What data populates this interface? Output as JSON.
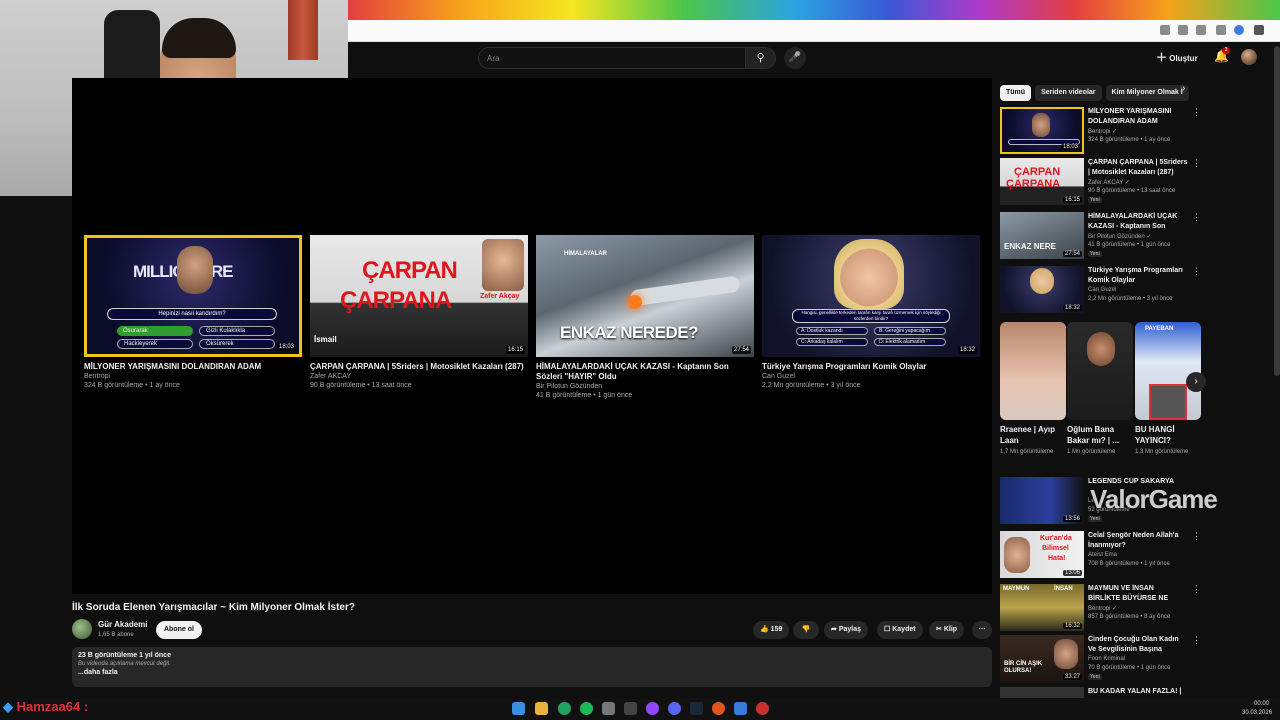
{
  "header": {
    "search_placeholder": "Ara",
    "create_label": "Oluştur",
    "notification_count": "3"
  },
  "colors": {
    "background": "#0f0f0f",
    "surface": "#272727",
    "text": "#f1f1f1",
    "muted": "#aaaaaa",
    "accent_red": "#cc0000"
  },
  "endscreen": [
    {
      "title": "MİLYONER YARIŞMASINI DOLANDIRAN ADAM",
      "channel": "Bentropi",
      "meta": "324 B görüntüleme • 1 ay önce",
      "duration": "18:03"
    },
    {
      "title": "ÇARPAN ÇARPANA | 5Sriders | Motosiklet Kazaları (287)",
      "channel": "Zafer AKCAY",
      "meta": "90 B görüntüleme • 13 saat önce",
      "duration": "16:15"
    },
    {
      "title": "HİMALAYALARDAKİ UÇAK KAZASI - Kaptanın Son Sözleri \"HAYIR\" Oldu",
      "channel": "Bir Pilotun Gözünden",
      "meta": "41 B görüntüleme • 1 gün önce",
      "duration": "27:54"
    },
    {
      "title": "Türkiye Yarışma Programları Komik Olaylar",
      "channel": "Can Guzel",
      "meta": "2,2 Mn görüntüleme • 3 yıl önce",
      "duration": "18:32"
    }
  ],
  "thumb_text": {
    "millionaire_logo": "MILLIONAIRE",
    "millionaire_question": "Hepinizi nasıl kandırdım?",
    "millionaire_a": "Osurarak",
    "millionaire_b": "Gizli Kulaklıkla",
    "millionaire_c": "Hackleyerek",
    "millionaire_d": "Öksürerek",
    "carpan_line1": "ÇARPAN",
    "carpan_line2": "ÇARPANA",
    "carpan_name": "Zafer Akçay",
    "carpan_tag": "İsmail",
    "enkaz": "ENKAZ NEREDE?",
    "enkaz_logo": "HİMALAYALAR",
    "quiz_question": "Hangisi, genellikle terkeden tarafın karşı tarafı üzmemek için söylediği sözlerden biridir?",
    "quiz_a": "A: Dostluk kazandı",
    "quiz_b": "B: Gereğini yapacağım",
    "quiz_c": "C: Arkadaş kalalım",
    "quiz_d": "D: Elektrik alamadım"
  },
  "video": {
    "title": "İlk Soruda Elenen Yarışmacılar ~ Kim Milyoner Olmak İster?",
    "channel": "Gür Akademi",
    "subscribers": "1,65 B abone",
    "subscribe_label": "Abone ol",
    "likes": "159",
    "share_label": "Paylaş",
    "save_label": "Kaydet",
    "clip_label": "Klip",
    "views_date": "23 B görüntüleme  1 yıl önce",
    "description": "Bu videoda açıklama mevcut değil.",
    "more_label": "...daha fazla"
  },
  "chips": [
    "Tümü",
    "Seriden videolar",
    "Kim Milyoner Olmak İ"
  ],
  "recommendations_top": [
    {
      "title": "MİLYONER YARIŞMASINI DOLANDIRAN ADAM",
      "channel": "Bentropi ✓",
      "meta": "324 B görüntüleme • 1 ay önce",
      "duration": "18:03",
      "badge": ""
    },
    {
      "title": "ÇARPAN ÇARPANA | 5Sriders | Motosiklet Kazaları (287)",
      "channel": "Zafer AKCAY ✓",
      "meta": "90 B görüntüleme • 13 saat önce",
      "duration": "16:15",
      "badge": "Yeni"
    },
    {
      "title": "HİMALAYALARDAKİ UÇAK KAZASI - Kaptanın Son Sözleri...",
      "channel": "Bir Pilotun Gözünden ✓",
      "meta": "41 B görüntüleme • 1 gün önce",
      "duration": "27:54",
      "badge": "Yeni"
    },
    {
      "title": "Türkiye Yarışma Programları Komik Olaylar",
      "channel": "Can Guzel",
      "meta": "2,2 Mn görüntüleme • 3 yıl önce",
      "duration": "18:32",
      "badge": ""
    }
  ],
  "shorts": [
    {
      "title": "Rraenee | Ayıp Laan",
      "meta": "1,7 Mn görüntüleme"
    },
    {
      "title": "Oğlum Bana Bakar mı? | ...",
      "meta": "1 Mn görüntüleme"
    },
    {
      "title": "BU HANGİ YAYINCI?",
      "meta": "1,3 Mn görüntüleme"
    }
  ],
  "recommendations_bottom": [
    {
      "title": "LEGENDS CUP SAKARYA",
      "channel": "Le",
      "meta": "52 görüntüleme",
      "duration": "13:56",
      "badge": "Yeni"
    },
    {
      "title": "Celal Şengör Neden Allah'a İnanmıyor?",
      "channel": "Ateist Ema",
      "meta": "708 B görüntüleme • 1 yıl önce",
      "duration": "13:06",
      "badge": ""
    },
    {
      "title": "MAYMUN VE İNSAN BİRLİKTE BÜYÜRSE NE OLUR?",
      "channel": "Bentropi ✓",
      "meta": "857 B görüntüleme • 8 ay önce",
      "duration": "16:32",
      "badge": ""
    },
    {
      "title": "Cinden Çocuğu Olan Kadın Ve Sevgilisinin Başına Gelenler | ...",
      "channel": "Foon Kriminal",
      "meta": "70 B görüntüleme • 1 gün önce",
      "duration": "33:27",
      "badge": "Yeni"
    },
    {
      "title": "BU KADAR YALAN FAZLA! |",
      "channel": "",
      "meta": "",
      "duration": "",
      "badge": ""
    }
  ],
  "rec_thumb_text": {
    "r2_line1": "ÇARPAN",
    "r2_line2": "ÇARPANA",
    "r3": "ENKAZ NERE",
    "b2_line1": "Kur'an'da",
    "b2_line2": "Bilimsel",
    "b2_line3": "Hata!",
    "b3_a": "MAYMUN",
    "b3_b": "İNSAN",
    "b4": "BİR CİN AŞIK OLURSA!",
    "s3_top": "PAYEBAN"
  },
  "overlay": {
    "watermark": "ValorGame",
    "streamer_name": "Hamzaa64"
  },
  "taskbar": {
    "time": "00:00",
    "date": "30.03.2026"
  }
}
